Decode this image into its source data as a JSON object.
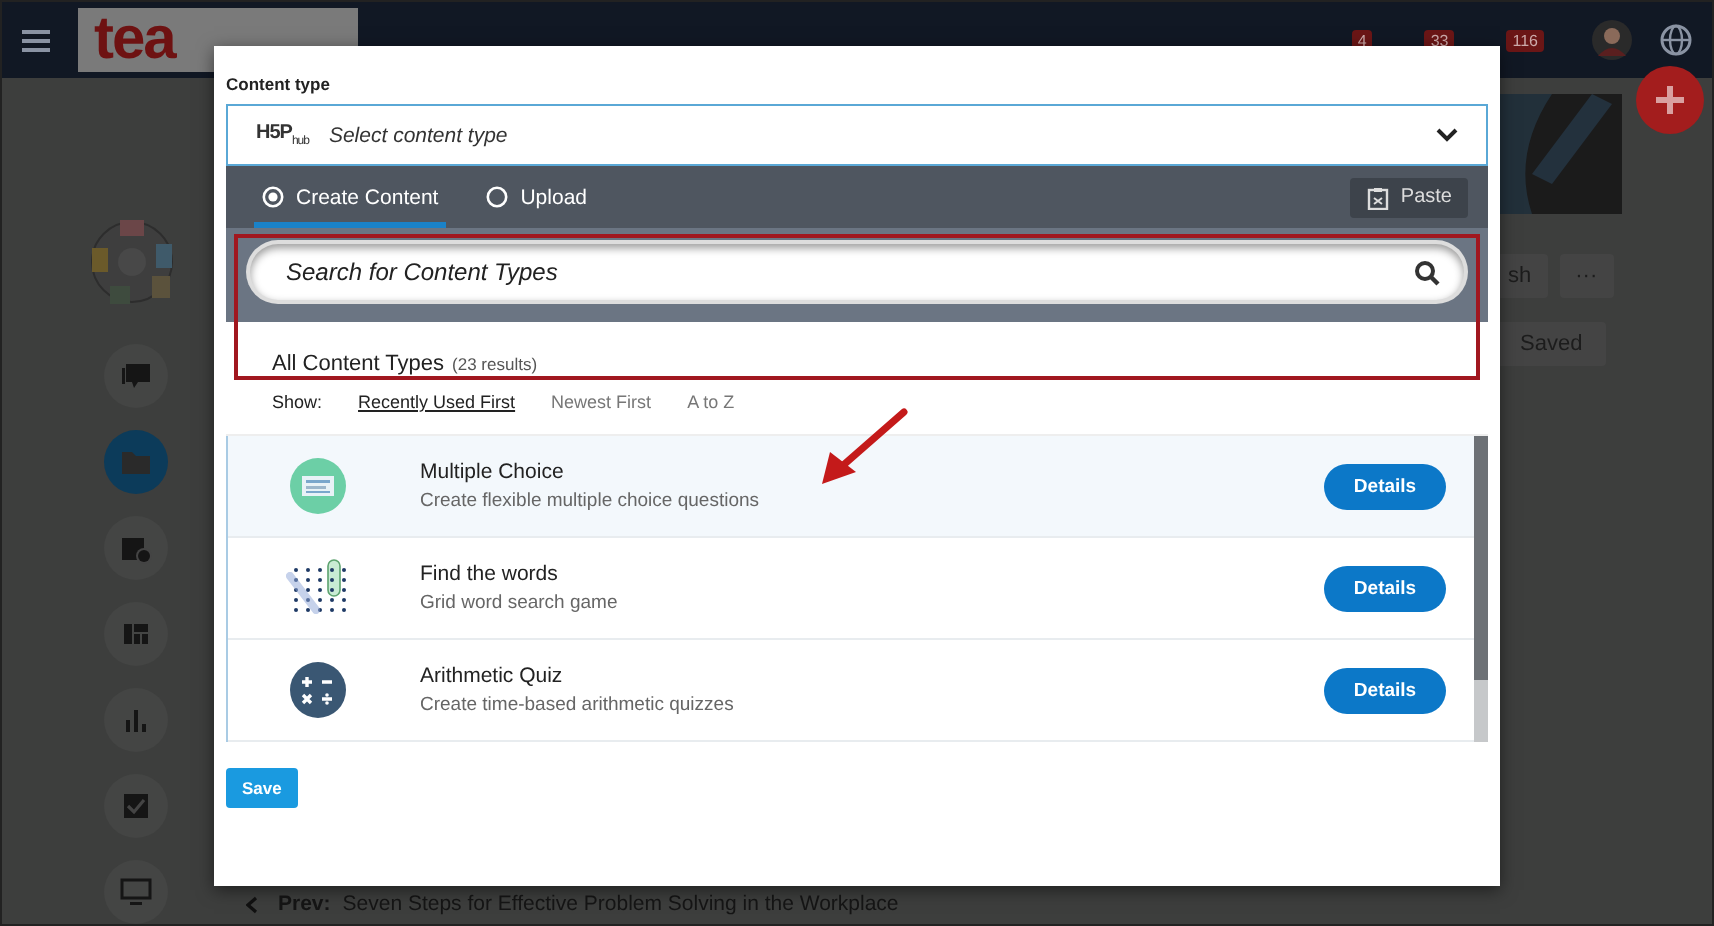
{
  "top_bar": {
    "logo": "tea",
    "badges": [
      {
        "count": "4"
      },
      {
        "count": "33"
      },
      {
        "count": "116"
      }
    ]
  },
  "sidebar": {
    "items": [
      {
        "kind": "chat",
        "selected": false
      },
      {
        "kind": "folder",
        "selected": true
      },
      {
        "kind": "calendar",
        "selected": false
      },
      {
        "kind": "dashboard",
        "selected": false
      },
      {
        "kind": "chart",
        "selected": false
      },
      {
        "kind": "check",
        "selected": false
      },
      {
        "kind": "monitor",
        "selected": false
      }
    ]
  },
  "background_buttons": [
    {
      "label": "sh"
    },
    {
      "label": "···"
    },
    {
      "label": "Saved"
    }
  ],
  "prev_link": {
    "label": "Prev:",
    "title": "Seven Steps for Effective Problem Solving in the Workplace"
  },
  "modal": {
    "field_label": "Content type",
    "select": {
      "hub": "H5P",
      "hub_suffix": "hub",
      "placeholder": "Select content type"
    },
    "tabs": [
      {
        "label": "Create Content",
        "selected": true
      },
      {
        "label": "Upload",
        "selected": false
      }
    ],
    "paste_button": "Paste",
    "search": {
      "placeholder": "Search for Content Types"
    },
    "heading": "All Content Types",
    "result_count": "(23 results)",
    "show_label": "Show:",
    "sort_options": [
      {
        "label": "Recently Used First",
        "selected": true
      },
      {
        "label": "Newest First",
        "selected": false
      },
      {
        "label": "A to Z",
        "selected": false
      }
    ],
    "content_types": [
      {
        "kind": "multiple-choice",
        "title": "Multiple Choice",
        "summary": "Create flexible multiple choice questions",
        "button": "Details",
        "selected": true
      },
      {
        "kind": "find-words",
        "title": "Find the words",
        "summary": "Grid word search game",
        "button": "Details",
        "selected": false
      },
      {
        "kind": "arithmetic",
        "title": "Arithmetic Quiz",
        "summary": "Create time-based arithmetic quizzes",
        "button": "Details",
        "selected": false
      }
    ],
    "save_button": "Save"
  }
}
